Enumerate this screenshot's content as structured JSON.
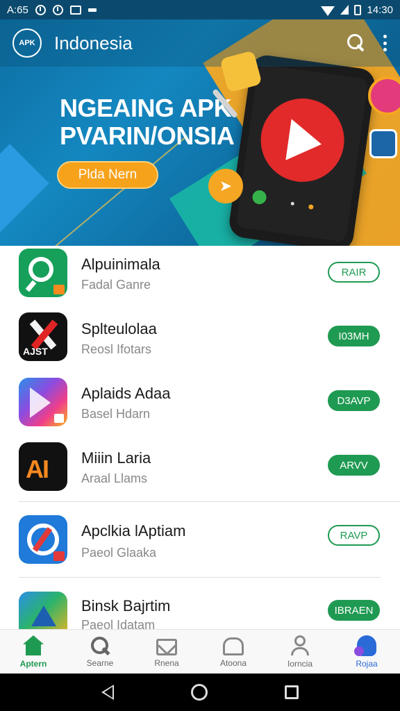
{
  "status_bar": {
    "left_text": "A:65",
    "time": "14:30"
  },
  "header": {
    "logo_text": "APK",
    "title": "Indonesia"
  },
  "banner": {
    "title_line1": "NGEAING APK",
    "title_line2": "PVARIN/ONSIA",
    "cta": "Plda Nern"
  },
  "apps": [
    {
      "name": "Alpuinimala",
      "category": "Fadal Ganre",
      "action": "RAIR",
      "style": "outline"
    },
    {
      "name": "Splteulolaa",
      "category": "Reosl Ifotars",
      "action": "I03MH",
      "style": "filled",
      "icon_text": "AJST"
    },
    {
      "name": "Aplaids Adaa",
      "category": "Basel Hdarn",
      "action": "D3AVP",
      "style": "filled"
    },
    {
      "name": "Miiin Laria",
      "category": "Araal Llams",
      "action": "ARVV",
      "style": "filled"
    },
    {
      "name": "Apclkia lAptiam",
      "category": "Paeol Glaaka",
      "action": "RAVP",
      "style": "outline"
    },
    {
      "name": "Binsk Bajrtim",
      "category": "Paeol Idatam",
      "action": "IBRAEN",
      "style": "filled"
    }
  ],
  "bottom_nav": [
    {
      "label": "Aptern",
      "icon": "home-icon",
      "active": true
    },
    {
      "label": "Searne",
      "icon": "search-icon"
    },
    {
      "label": "Rnena",
      "icon": "mail-icon"
    },
    {
      "label": "Atoona",
      "icon": "updates-icon"
    },
    {
      "label": "Iorncia",
      "icon": "profile-icon"
    },
    {
      "label": "Rojaa",
      "icon": "games-icon"
    }
  ],
  "colors": {
    "accent_green": "#1f9a52",
    "banner_blue": "#1487c0",
    "banner_orange": "#f5a623"
  }
}
